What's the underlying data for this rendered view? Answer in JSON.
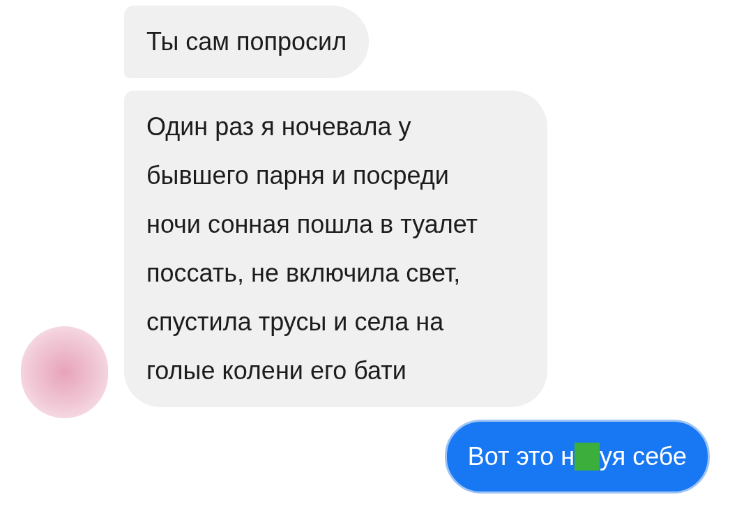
{
  "messages": [
    {
      "kind": "incoming",
      "lines": [
        "Ты сам попросил"
      ]
    },
    {
      "kind": "incoming",
      "lines": [
        "Один раз я ночевала у",
        "бывшего парня и посреди",
        "ночи сонная пошла в туалет",
        "поссать, не включила свет,",
        "спустила трусы и села на",
        "голые колени его бати"
      ],
      "avatar": true
    },
    {
      "kind": "outgoing",
      "parts": [
        {
          "kind": "text",
          "text": "Вот это н"
        },
        {
          "kind": "censor"
        },
        {
          "kind": "text",
          "text": "уя себе"
        }
      ]
    }
  ]
}
